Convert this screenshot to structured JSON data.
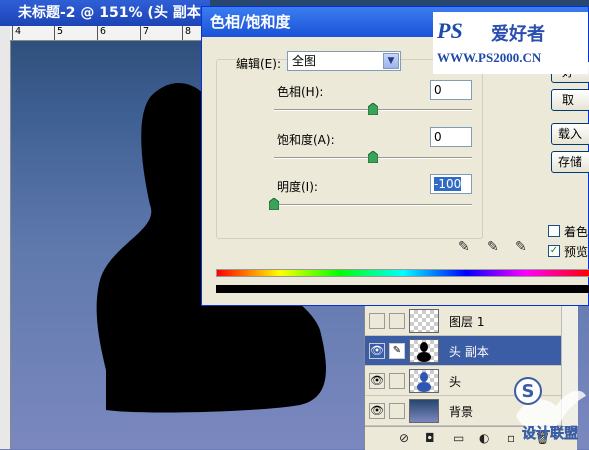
{
  "document": {
    "title": "未标题-2 @ 151% (头 副本",
    "ruler_ticks": [
      "4",
      "5",
      "6",
      "7",
      "8"
    ]
  },
  "dialog": {
    "title": "色相/饱和度",
    "edit_label": "编辑(E):",
    "edit_value": "全图",
    "hue_label": "色相(H):",
    "hue_value": "0",
    "saturation_label": "饱和度(A):",
    "saturation_value": "0",
    "lightness_label": "明度(I):",
    "lightness_value": "-100",
    "slider_levels": {
      "hue": 0.5,
      "saturation": 0.5,
      "lightness": 0.0
    },
    "buttons": {
      "ok": "好",
      "cancel": "取",
      "load": "载入",
      "save": "存储"
    },
    "colorize_label": "着色",
    "colorize_checked": false,
    "preview_label": "预览",
    "preview_checked": true
  },
  "logo": {
    "ps": "PS",
    "cn": "爱好者",
    "url": "WWW.PS2000.CN"
  },
  "layers": [
    {
      "name": "图层 1",
      "visible": false,
      "active": false
    },
    {
      "name": "头 副本",
      "visible": true,
      "active": true
    },
    {
      "name": "头",
      "visible": true,
      "active": false
    },
    {
      "name": "背景",
      "visible": true,
      "active": false
    }
  ],
  "watermark": {
    "main": "S",
    "sub": "设计联盟"
  },
  "icons": {
    "eye": "eye-icon",
    "brush": "brush-icon",
    "dropdown": "chevron-down-icon",
    "eyedropper": "eyedropper-icon"
  }
}
